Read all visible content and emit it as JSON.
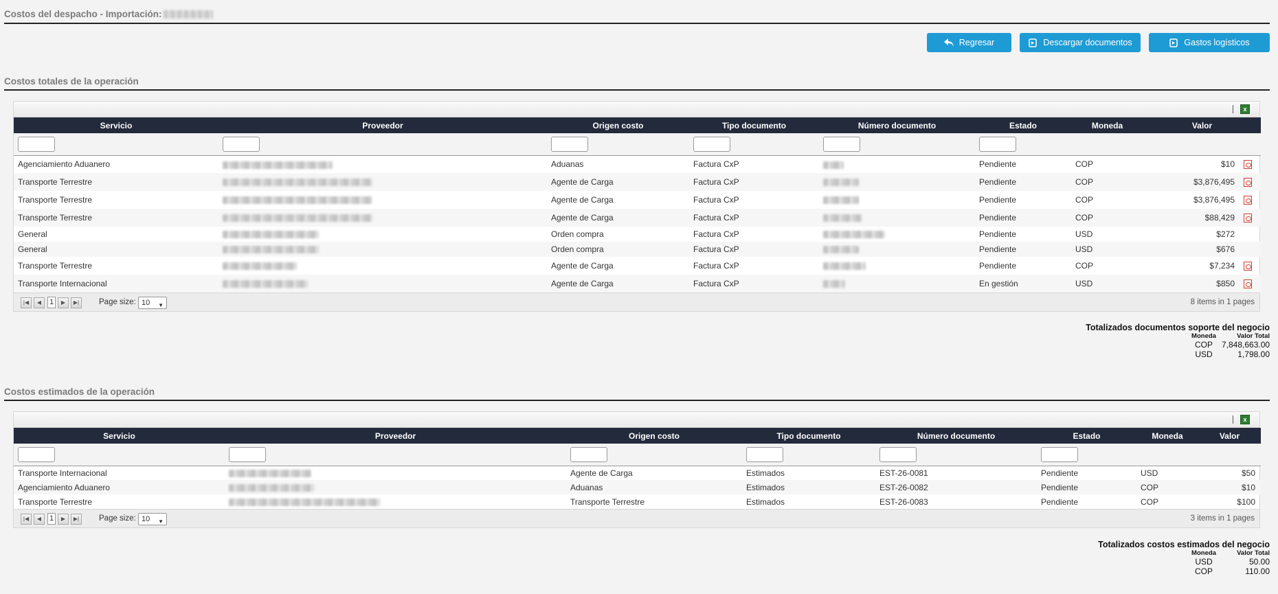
{
  "header": {
    "title": "Costos del despacho - Importación:",
    "buttons": {
      "back": "Regresar",
      "download": "Descargar documentos",
      "logistics": "Gastos logísticos"
    }
  },
  "colors": {
    "accent": "#1e9bd4",
    "header_bg": "#232a3b",
    "pdf": "#d03a2e"
  },
  "totales": {
    "title": "Costos totales de la operación",
    "columns": [
      "Servicio",
      "Proveedor",
      "Origen costo",
      "Tipo documento",
      "Número documento",
      "Estado",
      "Moneda",
      "Valor"
    ],
    "rows": [
      {
        "servicio": "Agenciamiento Aduanero",
        "origen": "Aduanas",
        "tipo": "Factura CxP",
        "estado": "Pendiente",
        "moneda": "COP",
        "valor": "$10",
        "pdf": true
      },
      {
        "servicio": "Transporte Terrestre",
        "origen": "Agente de Carga",
        "tipo": "Factura CxP",
        "estado": "Pendiente",
        "moneda": "COP",
        "valor": "$3,876,495",
        "pdf": true
      },
      {
        "servicio": "Transporte Terrestre",
        "origen": "Agente de Carga",
        "tipo": "Factura CxP",
        "estado": "Pendiente",
        "moneda": "COP",
        "valor": "$3,876,495",
        "pdf": true
      },
      {
        "servicio": "Transporte Terrestre",
        "origen": "Agente de Carga",
        "tipo": "Factura CxP",
        "estado": "Pendiente",
        "moneda": "COP",
        "valor": "$88,429",
        "pdf": true
      },
      {
        "servicio": "General",
        "origen": "Orden compra",
        "tipo": "Factura CxP",
        "estado": "Pendiente",
        "moneda": "USD",
        "valor": "$272",
        "pdf": false
      },
      {
        "servicio": "General",
        "origen": "Orden compra",
        "tipo": "Factura CxP",
        "estado": "Pendiente",
        "moneda": "USD",
        "valor": "$676",
        "pdf": false
      },
      {
        "servicio": "Transporte Terrestre",
        "origen": "Agente de Carga",
        "tipo": "Factura CxP",
        "estado": "Pendiente",
        "moneda": "COP",
        "valor": "$7,234",
        "pdf": true
      },
      {
        "servicio": "Transporte Internacional",
        "origen": "Agente de Carga",
        "tipo": "Factura CxP",
        "estado": "En gestión",
        "moneda": "USD",
        "valor": "$850",
        "pdf": true
      }
    ],
    "pager": {
      "page": "1",
      "size_label": "Page size:",
      "size": "10",
      "summary": "8 items in 1 pages"
    },
    "summary": {
      "title": "Totalizados documentos soporte del negocio",
      "col_moneda": "Moneda",
      "col_valor": "Valor Total",
      "rows": [
        {
          "moneda": "COP",
          "valor": "7,848,663.00"
        },
        {
          "moneda": "USD",
          "valor": "1,798.00"
        }
      ]
    }
  },
  "estimados": {
    "title": "Costos estimados de la operación",
    "columns": [
      "Servicio",
      "Proveedor",
      "Origen costo",
      "Tipo documento",
      "Número documento",
      "Estado",
      "Moneda",
      "Valor"
    ],
    "rows": [
      {
        "servicio": "Transporte Internacional",
        "origen": "Agente de Carga",
        "tipo": "Estimados",
        "numero": "EST-26-0081",
        "estado": "Pendiente",
        "moneda": "USD",
        "valor": "$50"
      },
      {
        "servicio": "Agenciamiento Aduanero",
        "origen": "Aduanas",
        "tipo": "Estimados",
        "numero": "EST-26-0082",
        "estado": "Pendiente",
        "moneda": "COP",
        "valor": "$10"
      },
      {
        "servicio": "Transporte Terrestre",
        "origen": "Transporte Terrestre",
        "tipo": "Estimados",
        "numero": "EST-26-0083",
        "estado": "Pendiente",
        "moneda": "COP",
        "valor": "$100"
      }
    ],
    "pager": {
      "page": "1",
      "size_label": "Page size:",
      "size": "10",
      "summary": "3 items in 1 pages"
    },
    "summary": {
      "title": "Totalizados costos estimados del negocio",
      "col_moneda": "Moneda",
      "col_valor": "Valor Total",
      "rows": [
        {
          "moneda": "USD",
          "valor": "50.00"
        },
        {
          "moneda": "COP",
          "valor": "110.00"
        }
      ]
    }
  }
}
